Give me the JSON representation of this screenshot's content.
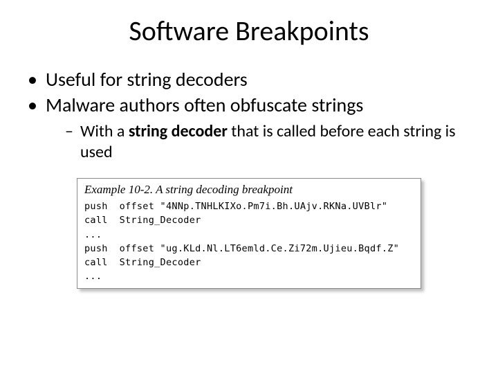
{
  "title": "Software Breakpoints",
  "bullets": {
    "b1": "Useful for string decoders",
    "b2": "Malware authors often obfuscate strings",
    "sub1_pre": "With a ",
    "sub1_bold": "string decoder",
    "sub1_post": " that is called before each string is used"
  },
  "codebox": {
    "caption": "Example 10-2. A string decoding breakpoint",
    "line1": "push  offset \"4NNp.TNHLKIXo.Pm7i.Bh.UAjv.RKNa.UVBlr\"",
    "line2": "call  String_Decoder",
    "line3": "...",
    "line4": "push  offset \"ug.KLd.Nl.LT6emld.Ce.Zi72m.Ujieu.Bqdf.Z\"",
    "line5": "call  String_Decoder",
    "line6": "..."
  }
}
